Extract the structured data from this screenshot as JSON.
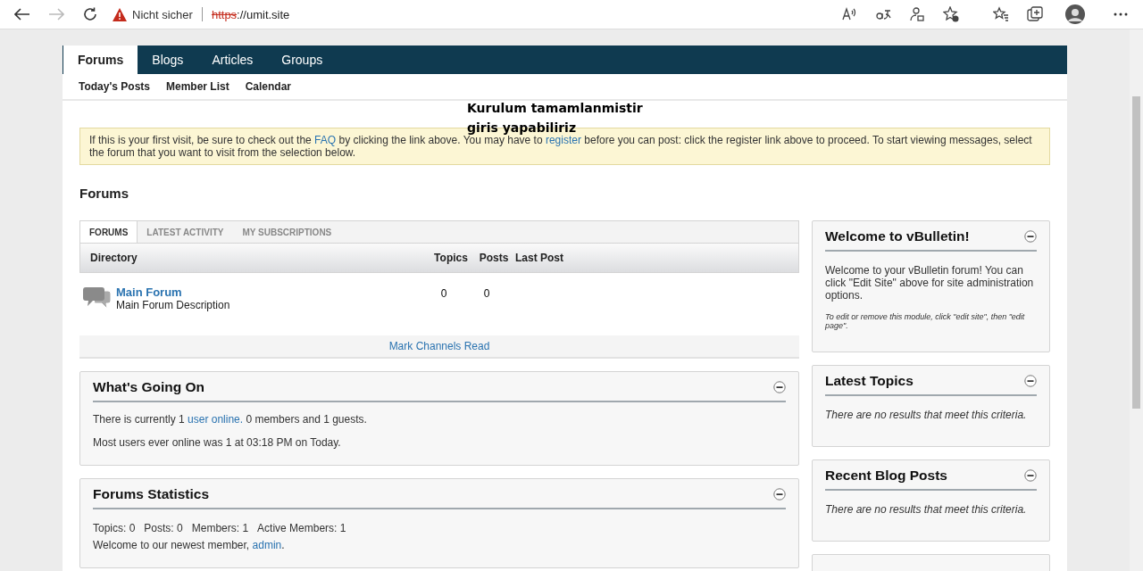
{
  "browser": {
    "security_label": "Nicht sicher",
    "url_scheme": "https",
    "url_rest": "://umit.site",
    "forward_disabled": true
  },
  "nav_tabs": [
    {
      "label": "Forums",
      "selected": true
    },
    {
      "label": "Blogs",
      "selected": false
    },
    {
      "label": "Articles",
      "selected": false
    },
    {
      "label": "Groups",
      "selected": false
    }
  ],
  "sub_nav": [
    "Today's Posts",
    "Member List",
    "Calendar"
  ],
  "overlay_note": "Kurulum tamamlanmistir\ngiris yapabiliriz",
  "notice": [
    {
      "text": "If this is your first visit, be sure to check out the ",
      "link": false
    },
    {
      "text": "FAQ",
      "link": true
    },
    {
      "text": " by clicking the link above. You may have to ",
      "link": false
    },
    {
      "text": "register",
      "link": true
    },
    {
      "text": " before you can post: click the register link above to proceed. To start viewing messages, select the forum that you want to visit from the selection below.",
      "link": false
    }
  ],
  "page_title": "Forums",
  "forum_tabs": [
    {
      "label": "FORUMS",
      "selected": true
    },
    {
      "label": "LATEST ACTIVITY",
      "selected": false
    },
    {
      "label": "MY SUBSCRIPTIONS",
      "selected": false
    }
  ],
  "table": {
    "columns": [
      "Directory",
      "Topics",
      "Posts",
      "Last Post"
    ],
    "rows": [
      {
        "name": "Main Forum",
        "description": "Main Forum Description",
        "topics": "0",
        "posts": "0"
      }
    ]
  },
  "mark_read": "Mark Channels Read",
  "main_widgets": [
    {
      "title": "What's Going On",
      "paragraphs": [
        [
          {
            "text": "There is currently 1 ",
            "link": false
          },
          {
            "text": "user online.",
            "link": true
          },
          {
            "text": " 0 members and 1 guests.",
            "link": false
          }
        ],
        [
          {
            "text": "Most users ever online was 1 at 03:18 PM on Today.",
            "link": false
          }
        ]
      ]
    },
    {
      "title": "Forums Statistics",
      "stats": [
        "Topics: 0",
        "Posts: 0",
        "Members: 1",
        "Active Members: 1"
      ],
      "paragraphs": [
        [
          {
            "text": "Welcome to our newest member, ",
            "link": false
          },
          {
            "text": "admin",
            "link": true
          },
          {
            "text": ".",
            "link": false
          }
        ]
      ]
    }
  ],
  "sidebar_widgets": [
    {
      "title": "Welcome to vBulletin!",
      "body": "Welcome to your vBulletin forum! You can click \"Edit Site\" above for site administration options.",
      "note": "To edit or remove this module, click \"edit site\", then \"edit page\"."
    },
    {
      "title": "Latest Topics",
      "empty_text": "There are no results that meet this criteria."
    },
    {
      "title": "Recent Blog Posts",
      "empty_text": "There are no results that meet this criteria."
    }
  ],
  "sidebar_card_cut_off": true
}
